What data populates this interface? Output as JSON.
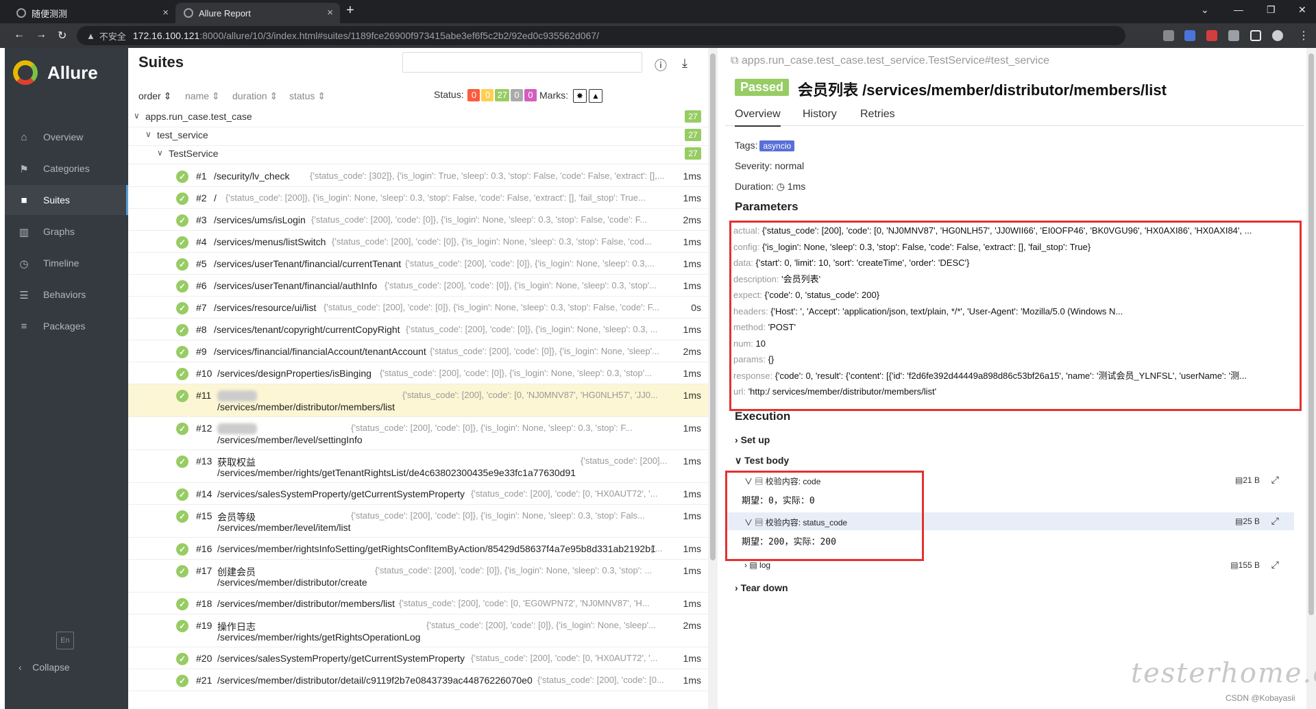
{
  "browser": {
    "tabs": [
      {
        "title": "随便测测"
      },
      {
        "title": "Allure Report"
      }
    ],
    "url_host": "172.16.100.121",
    "url_rest": ":8000/allure/10/3/index.html#suites/1189fce26900f973415abe3ef6f5c2b2/92ed0c935562d067/",
    "insecure_label": "不安全"
  },
  "app": {
    "name": "Allure"
  },
  "sidebar": {
    "items": [
      {
        "label": "Overview",
        "icon": "home-icon"
      },
      {
        "label": "Categories",
        "icon": "flag-icon"
      },
      {
        "label": "Suites",
        "icon": "briefcase-icon"
      },
      {
        "label": "Graphs",
        "icon": "bar-chart-icon"
      },
      {
        "label": "Timeline",
        "icon": "clock-icon"
      },
      {
        "label": "Behaviors",
        "icon": "list-icon"
      },
      {
        "label": "Packages",
        "icon": "align-left-icon"
      }
    ],
    "active": "Suites",
    "lang": "En",
    "collapse": "Collapse"
  },
  "suites": {
    "title": "Suites",
    "sort": {
      "order": "order",
      "name": "name",
      "duration": "duration",
      "status": "status"
    },
    "status_label": "Status:",
    "status_counts": [
      "0",
      "0",
      "27",
      "0",
      "0"
    ],
    "status_colors": [
      "#fd5a3e",
      "#ffd050",
      "#97cc64",
      "#aaaaaa",
      "#d35ebe"
    ],
    "marks_label": "Marks:",
    "tree": [
      {
        "label": "apps.run_case.test_case",
        "count": "27"
      },
      {
        "label": "test_service",
        "count": "27"
      },
      {
        "label": "TestService",
        "count": "27"
      }
    ],
    "rows": [
      {
        "num": "#1",
        "name": "/security/lv_check",
        "params": "{'status_code': [302]}, {'is_login': True, 'sleep': 0.3, 'stop': False, 'code': False, 'extract': [],...",
        "dur": "1ms"
      },
      {
        "num": "#2",
        "name": "/",
        "params": "{'status_code': [200]}, {'is_login': None, 'sleep': 0.3, 'stop': False, 'code': False, 'extract': [], 'fail_stop': True...",
        "dur": "1ms"
      },
      {
        "num": "#3",
        "name": "/services/ums/isLogin",
        "params": "{'status_code': [200], 'code': [0]}, {'is_login': None, 'sleep': 0.3, 'stop': False, 'code': F...",
        "dur": "2ms"
      },
      {
        "num": "#4",
        "name": "/services/menus/listSwitch",
        "params": "{'status_code': [200], 'code': [0]}, {'is_login': None, 'sleep': 0.3, 'stop': False, 'cod...",
        "dur": "1ms"
      },
      {
        "num": "#5",
        "name": "/services/userTenant/financial/currentTenant",
        "params": "{'status_code': [200], 'code': [0]}, {'is_login': None, 'sleep': 0.3,...",
        "dur": "1ms"
      },
      {
        "num": "#6",
        "name": "/services/userTenant/financial/authInfo",
        "params": "{'status_code': [200], 'code': [0]}, {'is_login': None, 'sleep': 0.3, 'stop'...",
        "dur": "1ms"
      },
      {
        "num": "#7",
        "name": "/services/resource/ui/list",
        "params": "{'status_code': [200], 'code': [0]}, {'is_login': None, 'sleep': 0.3, 'stop': False, 'code': F...",
        "dur": "0s"
      },
      {
        "num": "#8",
        "name": "/services/tenant/copyright/currentCopyRight",
        "params": "{'status_code': [200], 'code': [0]}, {'is_login': None, 'sleep': 0.3, ...",
        "dur": "1ms"
      },
      {
        "num": "#9",
        "name": "/services/financial/financialAccount/tenantAccount",
        "params": "{'status_code': [200], 'code': [0]}, {'is_login': None, 'sleep'...",
        "dur": "2ms"
      },
      {
        "num": "#10",
        "name": "/services/designProperties/isBinging",
        "params": "{'status_code': [200], 'code': [0]}, {'is_login': None, 'sleep': 0.3, 'stop'...",
        "dur": "1ms"
      },
      {
        "num": "#11",
        "name": "",
        "name2": "/services/member/distributor/members/list",
        "params": "{'status_code': [200], 'code': [0, 'NJ0MNV87', 'HG0NLH57', 'JJ0...",
        "dur": "1ms"
      },
      {
        "num": "#12",
        "name": "",
        "name2": "/services/member/level/settingInfo",
        "params": "{'status_code': [200], 'code': [0]}, {'is_login': None, 'sleep': 0.3, 'stop': F...",
        "dur": "1ms"
      },
      {
        "num": "#13",
        "name": "获取权益",
        "name2": "/services/member/rights/getTenantRightsList/de4c63802300435e9e33fc1a77630d91",
        "params": "{'status_code': [200]...",
        "dur": "1ms"
      },
      {
        "num": "#14",
        "name": "/services/salesSystemProperty/getCurrentSystemProperty",
        "params": "{'status_code': [200], 'code': [0, 'HX0AUT72', '...",
        "dur": "1ms"
      },
      {
        "num": "#15",
        "name": "会员等级",
        "name2": "/services/member/level/item/list",
        "params": "{'status_code': [200], 'code': [0]}, {'is_login': None, 'sleep': 0.3, 'stop': Fals...",
        "dur": "1ms"
      },
      {
        "num": "#16",
        "name": "/services/member/rightsInfoSetting/getRightsConfItemByAction/85429d58637f4a7e95b8d331ab2192b1",
        "params": "{'...",
        "dur": "1ms"
      },
      {
        "num": "#17",
        "name": "创建会员",
        "name2": "/services/member/distributor/create",
        "params": "{'status_code': [200], 'code': [0]}, {'is_login': None, 'sleep': 0.3, 'stop': ...",
        "dur": "1ms"
      },
      {
        "num": "#18",
        "name": "/services/member/distributor/members/list",
        "params": "{'status_code': [200], 'code': [0, 'EG0WPN72', 'NJ0MNV87', 'H...",
        "dur": "1ms"
      },
      {
        "num": "#19",
        "name": "操作日志",
        "name2": "/services/member/rights/getRightsOperationLog",
        "params": "{'status_code': [200], 'code': [0]}, {'is_login': None, 'sleep'...",
        "dur": "2ms"
      },
      {
        "num": "#20",
        "name": "/services/salesSystemProperty/getCurrentSystemProperty",
        "params": "{'status_code': [200], 'code': [0, 'HX0AUT72', '...",
        "dur": "1ms"
      },
      {
        "num": "#21",
        "name": "/services/member/distributor/detail/c9119f2b7e0843739ac44876226070e0",
        "params": "{'status_code': [200], 'code': [0...",
        "dur": "1ms"
      }
    ]
  },
  "detail": {
    "breadcrumb": "apps.run_case.test_case.test_service.TestService#test_service",
    "status": "Passed",
    "title": "会员列表 /services/member/distributor/members/list",
    "tabs": [
      "Overview",
      "History",
      "Retries"
    ],
    "tags_label": "Tags:",
    "tag": "asyncio",
    "severity": "Severity: normal",
    "duration_label": "Duration:",
    "duration": "1ms",
    "parameters_title": "Parameters",
    "params": [
      {
        "k": "actual:",
        "v": "{'status_code': [200], 'code': [0, 'NJ0MNV87', 'HG0NLH57', 'JJ0WII66', 'EI0OFP46', 'BK0VGU96', 'HX0AXI86', 'HX0AXI84', ..."
      },
      {
        "k": "config:",
        "v": "{'is_login': None, 'sleep': 0.3, 'stop': False, 'code': False, 'extract': [], 'fail_stop': True}"
      },
      {
        "k": "data:",
        "v": "{'start': 0, 'limit': 10, 'sort': 'createTime', 'order': 'DESC'}"
      },
      {
        "k": "description:",
        "v": "'会员列表'"
      },
      {
        "k": "expect:",
        "v": "{'code': 0, 'status_code': 200}"
      },
      {
        "k": "headers:",
        "v": "{'Host':                                              ', 'Accept': 'application/json, text/plain, */*', 'User-Agent': 'Mozilla/5.0 (Windows N..."
      },
      {
        "k": "method:",
        "v": "'POST'"
      },
      {
        "k": "num:",
        "v": "10"
      },
      {
        "k": "params:",
        "v": "{}"
      },
      {
        "k": "response:",
        "v": "{'code': 0, 'result': {'content': [{'id': 'f2d6fe392d44449a898d86c53bf26a15', 'name': '测试会员_YLNFSL', 'userName': '测..."
      },
      {
        "k": "url:",
        "v": "'http:/                                      services/member/distributor/members/list'"
      }
    ],
    "execution_title": "Execution",
    "setup": "Set up",
    "test_body": "Test body",
    "teardown": "Tear down",
    "steps": [
      {
        "label": "校验内容: code",
        "size": "21 B",
        "body": "期望：0，实际：0"
      },
      {
        "label": "校验内容: status_code",
        "size": "25 B",
        "body": "期望：200，实际：200"
      },
      {
        "label": "log",
        "size": "155 B"
      }
    ]
  },
  "watermark": "testerhome.com",
  "credit": "CSDN @Kobayasii"
}
